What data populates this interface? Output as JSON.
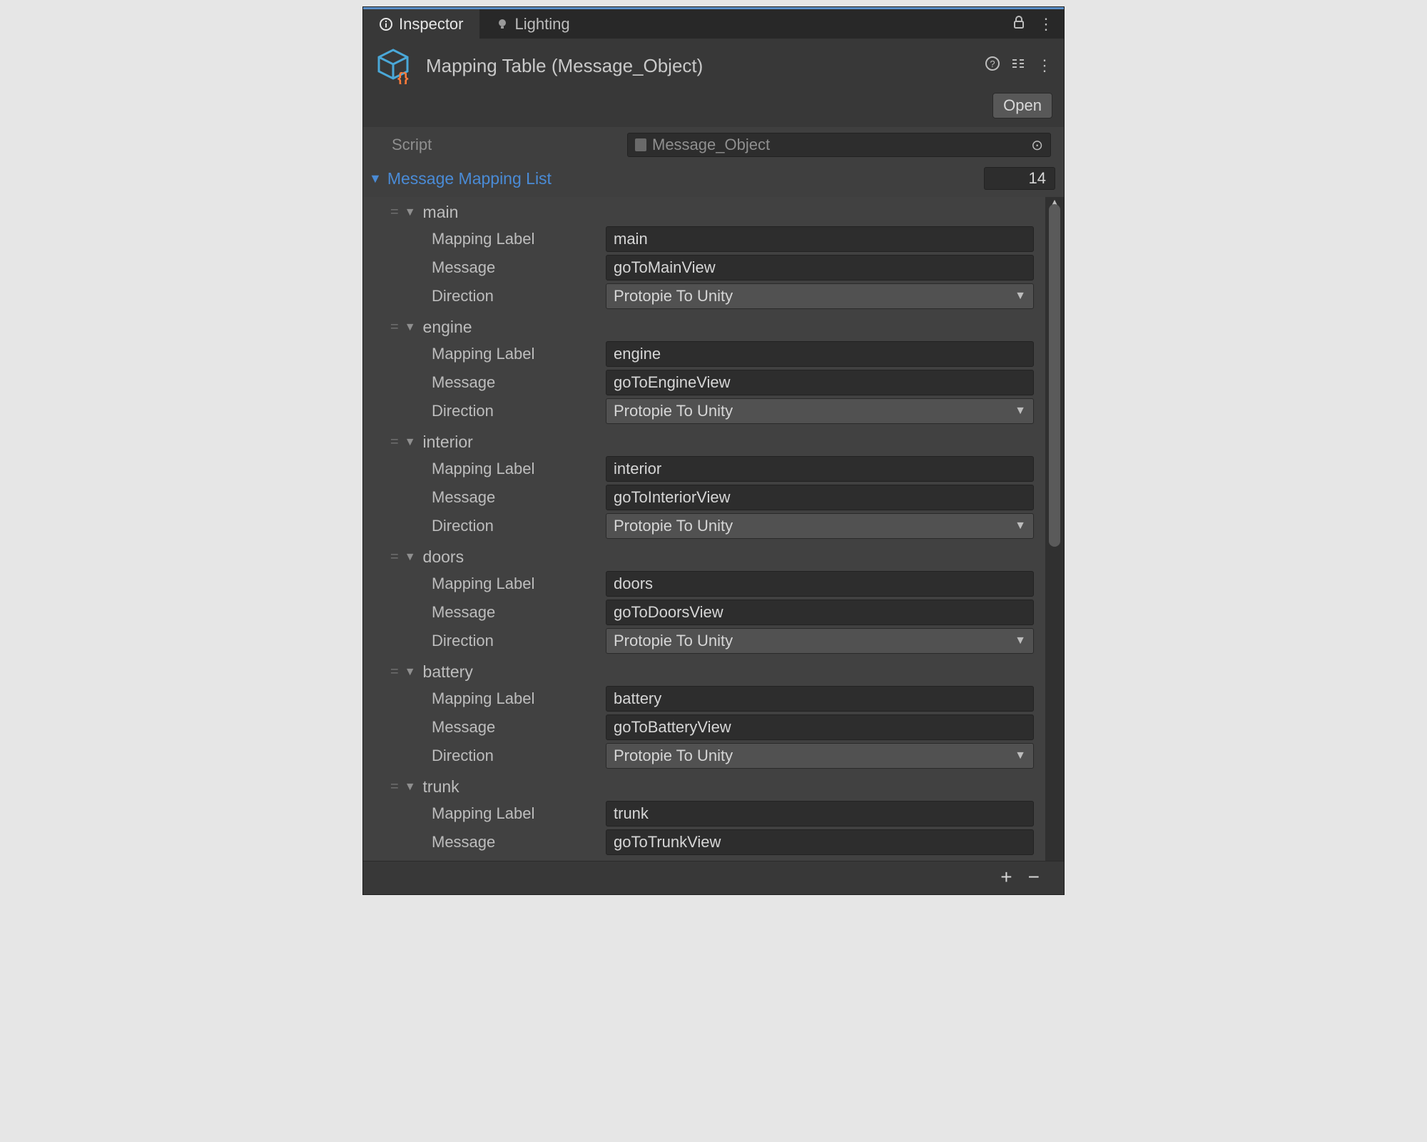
{
  "tabs": {
    "inspector": "Inspector",
    "lighting": "Lighting"
  },
  "header": {
    "title": "Mapping Table (Message_Object)",
    "open_label": "Open"
  },
  "script": {
    "label": "Script",
    "value": "Message_Object"
  },
  "list": {
    "title": "Message Mapping List",
    "count": "14",
    "field_labels": {
      "mapping_label": "Mapping Label",
      "message": "Message",
      "direction": "Direction"
    },
    "items": [
      {
        "name": "main",
        "mapping_label": "main",
        "message": "goToMainView",
        "direction": "Protopie To Unity"
      },
      {
        "name": "engine",
        "mapping_label": "engine",
        "message": "goToEngineView",
        "direction": "Protopie To Unity"
      },
      {
        "name": "interior",
        "mapping_label": "interior",
        "message": "goToInteriorView",
        "direction": "Protopie To Unity"
      },
      {
        "name": "doors",
        "mapping_label": "doors",
        "message": "goToDoorsView",
        "direction": "Protopie To Unity"
      },
      {
        "name": "battery",
        "mapping_label": "battery",
        "message": "goToBatteryView",
        "direction": "Protopie To Unity"
      },
      {
        "name": "trunk",
        "mapping_label": "trunk",
        "message": "goToTrunkView"
      }
    ]
  }
}
